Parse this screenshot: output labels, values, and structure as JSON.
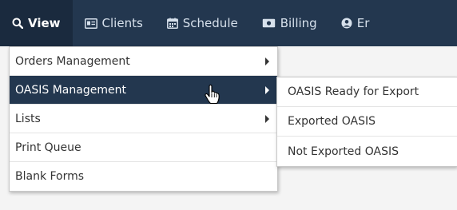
{
  "navbar": {
    "items": [
      {
        "label": "View",
        "icon": "search-icon",
        "active": true
      },
      {
        "label": "Clients",
        "icon": "id-card-icon"
      },
      {
        "label": "Schedule",
        "icon": "calendar-icon"
      },
      {
        "label": "Billing",
        "icon": "money-icon"
      },
      {
        "label": "Er",
        "icon": "user-circle-icon"
      }
    ]
  },
  "view_menu": {
    "items": [
      {
        "label": "Orders Management",
        "has_submenu": true
      },
      {
        "label": "OASIS Management",
        "has_submenu": true,
        "highlighted": true
      },
      {
        "label": "Lists",
        "has_submenu": true
      },
      {
        "label": "Print Queue"
      },
      {
        "label": "Blank Forms"
      }
    ]
  },
  "oasis_submenu": {
    "items": [
      {
        "label": "OASIS Ready for Export"
      },
      {
        "label": "Exported OASIS"
      },
      {
        "label": "Not Exported OASIS"
      }
    ]
  },
  "colors": {
    "navbar_bg": "#23374f",
    "active_bg": "#1a2a3e",
    "highlight_bg": "#23374f"
  },
  "cursor_icon": "hand-pointer-icon"
}
